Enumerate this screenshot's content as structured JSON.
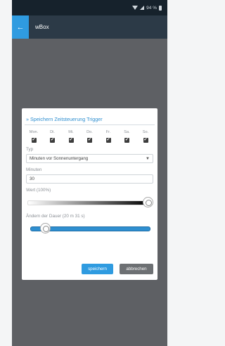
{
  "status_bar": {
    "battery_text": "94 %"
  },
  "app_bar": {
    "back_icon": "arrow-left-icon",
    "title": "wBox"
  },
  "dialog": {
    "title": "» Speichern Zeitsteuerung Trigger",
    "days": [
      {
        "label": "Mon.",
        "checked": true
      },
      {
        "label": "Di.",
        "checked": true
      },
      {
        "label": "Mi.",
        "checked": true
      },
      {
        "label": "Do.",
        "checked": true
      },
      {
        "label": "Fr.",
        "checked": true
      },
      {
        "label": "Sa.",
        "checked": true
      },
      {
        "label": "So.",
        "checked": true
      }
    ],
    "type_label": "Typ",
    "type_value": "Minuten vor Sonnenuntergang",
    "minutes_label": "Minuten",
    "minutes_value": "30",
    "value_label": "Wert (100%)",
    "value_percent": 100,
    "duration_label": "Ändern der Dauer (20 m 31 s)",
    "duration_fraction": 0.12,
    "save_label": "speichern",
    "cancel_label": "abbrechen"
  },
  "colors": {
    "accent": "#2f9be0",
    "app_bar": "#2c3a47",
    "status_bar": "#16222c",
    "overlay": "#5e6064",
    "cancel": "#6d7073"
  }
}
